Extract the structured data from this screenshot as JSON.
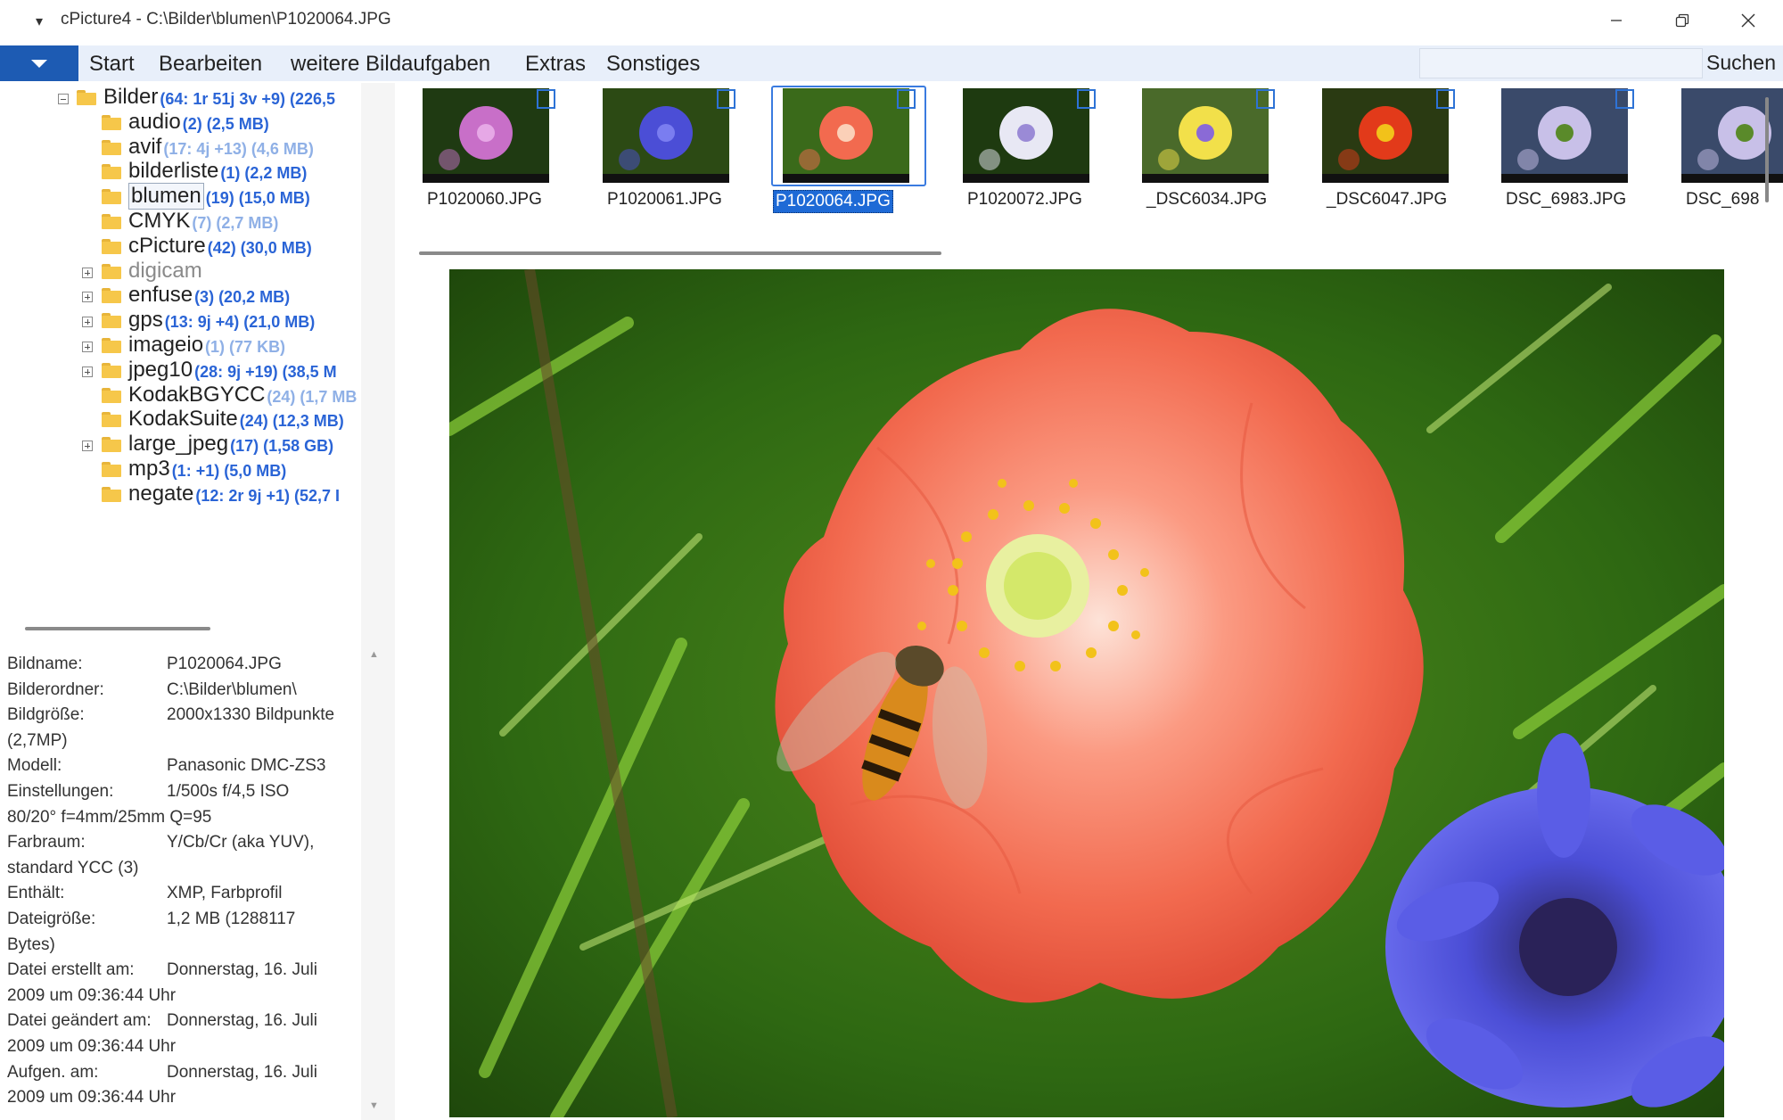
{
  "window": {
    "title": "cPicture4 - C:\\Bilder\\blumen\\P1020064.JPG",
    "sys_menu_glyph": "▾"
  },
  "menubar": {
    "items": [
      "Start",
      "Bearbeiten",
      "weitere Bildaufgaben",
      "Extras",
      "Sonstiges"
    ],
    "search_label": "Suchen",
    "search_value": ""
  },
  "tree": {
    "rows": [
      {
        "name": "Bilder",
        "count": "(64: 1r 51j 3v +9) (226,5",
        "expander": "minus",
        "level": 0
      },
      {
        "name": "audio",
        "count": "(2) (2,5 MB)",
        "expander": "none",
        "level": 1
      },
      {
        "name": "avif",
        "count": "(17: 4j +13) (4,6 MB)",
        "expander": "none",
        "level": 1,
        "light": true
      },
      {
        "name": "bilderliste",
        "count": "(1) (2,2 MB)",
        "expander": "none",
        "level": 1
      },
      {
        "name": "blumen",
        "count": "(19) (15,0 MB)",
        "expander": "none",
        "level": 1,
        "selected": true
      },
      {
        "name": "CMYK",
        "count": "(7) (2,7 MB)",
        "expander": "none",
        "level": 1,
        "light": true
      },
      {
        "name": "cPicture",
        "count": "(42) (30,0 MB)",
        "expander": "none",
        "level": 1
      },
      {
        "name": "digicam",
        "count": "",
        "expander": "plus",
        "level": 1,
        "grey": true
      },
      {
        "name": "enfuse",
        "count": "(3) (20,2 MB)",
        "expander": "plus",
        "level": 1
      },
      {
        "name": "gps",
        "count": "(13: 9j +4) (21,0 MB)",
        "expander": "plus",
        "level": 1
      },
      {
        "name": "imageio",
        "count": "(1) (77 KB)",
        "expander": "plus",
        "level": 1,
        "light": true
      },
      {
        "name": "jpeg10",
        "count": "(28: 9j +19) (38,5 M",
        "expander": "plus",
        "level": 1
      },
      {
        "name": "KodakBGYCC",
        "count": "(24) (1,7 MB",
        "expander": "none",
        "level": 1,
        "light": true
      },
      {
        "name": "KodakSuite",
        "count": "(24) (12,3 MB)",
        "expander": "none",
        "level": 1
      },
      {
        "name": "large_jpeg",
        "count": "(17) (1,58 GB)",
        "expander": "plus",
        "level": 1
      },
      {
        "name": "mp3",
        "count": "(1: +1) (5,0 MB)",
        "expander": "none",
        "level": 1
      },
      {
        "name": "negate",
        "count": "(12: 2r 9j +1) (52,7 I",
        "expander": "none",
        "level": 1
      }
    ]
  },
  "info": {
    "lines": [
      [
        "Bildname:",
        "P1020064.JPG"
      ],
      [
        "Bilderordner:",
        "C:\\Bilder\\blumen\\"
      ],
      [
        "Bildgröße:",
        "2000x1330 Bildpunkte"
      ],
      [
        "(2,7MP)",
        ""
      ],
      [
        "Modell:",
        "Panasonic DMC-ZS3"
      ],
      [
        "Einstellungen:",
        "1/500s f/4,5 ISO"
      ],
      [
        "80/20° f=4mm/25mm Q=95",
        ""
      ],
      [
        "Farbraum:",
        "Y/Cb/Cr (aka YUV),"
      ],
      [
        "standard YCC (3)",
        ""
      ],
      [
        "Enthält:",
        "XMP, Farbprofil"
      ],
      [
        "Dateigröße:",
        "1,2 MB (1288117"
      ],
      [
        "Bytes)",
        ""
      ],
      [
        "Datei erstellt am:",
        "Donnerstag, 16. Juli"
      ],
      [
        "2009 um 09:36:44 Uhr",
        ""
      ],
      [
        "Datei geändert am:",
        "Donnerstag, 16. Juli"
      ],
      [
        "2009 um 09:36:44 Uhr",
        ""
      ],
      [
        "Aufgen. am:",
        "Donnerstag, 16. Juli"
      ],
      [
        "2009 um 09:36:44 Uhr",
        ""
      ]
    ]
  },
  "thumbnails": {
    "items": [
      {
        "label": "P1020060.JPG",
        "selected": false,
        "subject": "pink-flower-icon"
      },
      {
        "label": "P1020061.JPG",
        "selected": false,
        "subject": "blue-cornflower-icon"
      },
      {
        "label": "P1020064.JPG",
        "selected": true,
        "subject": "red-poppy-icon"
      },
      {
        "label": "P1020072.JPG",
        "selected": false,
        "subject": "white-cornflower-icon"
      },
      {
        "label": "_DSC6034.JPG",
        "selected": false,
        "subject": "meadow-flowers-icon"
      },
      {
        "label": "_DSC6047.JPG",
        "selected": false,
        "subject": "red-yellow-flower-icon"
      },
      {
        "label": "DSC_6983.JPG",
        "selected": false,
        "subject": "lilac-icon"
      },
      {
        "label": "DSC_698",
        "selected": false,
        "subject": "lilac-icon"
      }
    ]
  },
  "colors": {
    "accent": "#1d5bb3",
    "menubar_bg": "#e8effa",
    "tree_count": "#2a64d6",
    "selection": "#1e6ad6"
  }
}
